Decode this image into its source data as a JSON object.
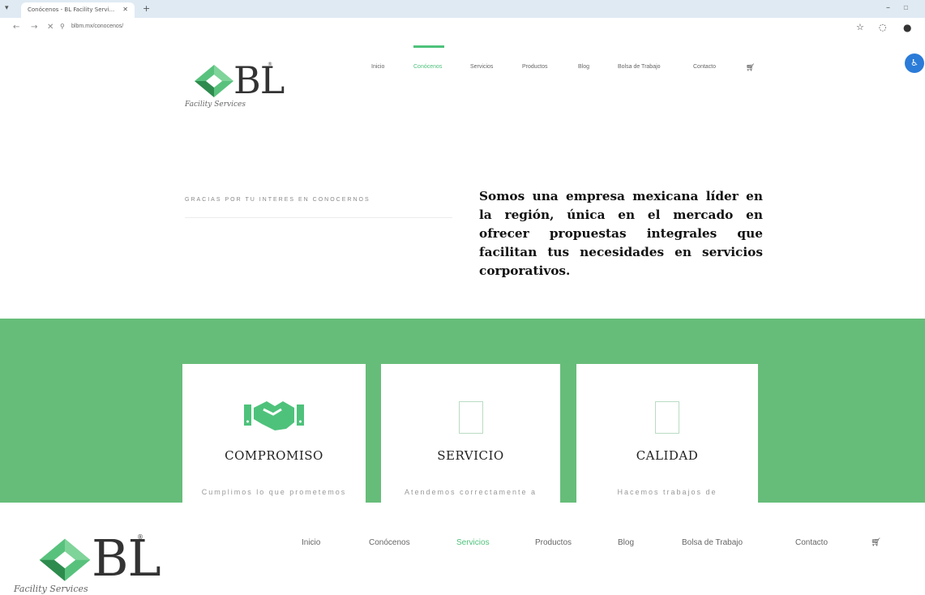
{
  "browser": {
    "tab_title": "Conócenos - BL Facility Servi...",
    "url": "blbm.mx/conocenos/",
    "icons": [
      "star-icon",
      "extensions-icon",
      "profile-icon",
      "menu-icon"
    ]
  },
  "header": {
    "logo_text": "BL",
    "logo_tagline": "Facility Services",
    "nav": [
      {
        "label": "Inicio"
      },
      {
        "label": "Conócenos"
      },
      {
        "label": "Servicios"
      },
      {
        "label": "Productos"
      },
      {
        "label": "Blog"
      },
      {
        "label": "Bolsa de Trabajo"
      },
      {
        "label": "Contacto"
      }
    ],
    "active_top": "Conócenos",
    "active_bottom": "Servicios"
  },
  "intro": {
    "eyebrow": "GRACIAS POR TU INTERES EN CONOCERNOS",
    "statement": "Somos una empresa mexicana líder en la región, única en el mercado en ofrecer propuestas integrales que facilitan tus necesidades en servicios corporativos."
  },
  "values": [
    {
      "title": "COMPROMISO",
      "desc": "Cumplimos lo que prometemos",
      "icon": "handshake-icon"
    },
    {
      "title": "SERVICIO",
      "desc": "Atendemos correctamente a",
      "icon": "placeholder-icon"
    },
    {
      "title": "CALIDAD",
      "desc": "Hacemos trabajos de",
      "icon": "placeholder-icon"
    }
  ],
  "colors": {
    "accent": "#4ec27b",
    "band": "#66bd79",
    "logo_dark": "#2e8b4e",
    "logo_light": "#58c27d"
  }
}
